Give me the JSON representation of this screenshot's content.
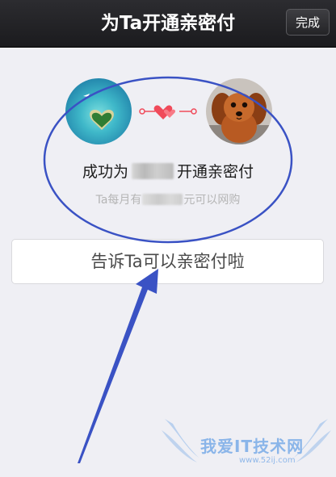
{
  "navbar": {
    "title": "为Ta开通亲密付",
    "done_label": "完成"
  },
  "success": {
    "prefix": "成功为",
    "suffix": "开通亲密付",
    "sub_prefix": "Ta每月有",
    "sub_suffix": "元可以网购"
  },
  "tell_button": {
    "label": "告诉Ta可以亲密付啦"
  },
  "watermark": {
    "text": "我爱IT技术网",
    "url": "www.52ij.com"
  },
  "colors": {
    "navbar": "#1f1f22",
    "background": "#efeff4",
    "heart": "#f04a5a",
    "annotation": "#3a52c4"
  }
}
